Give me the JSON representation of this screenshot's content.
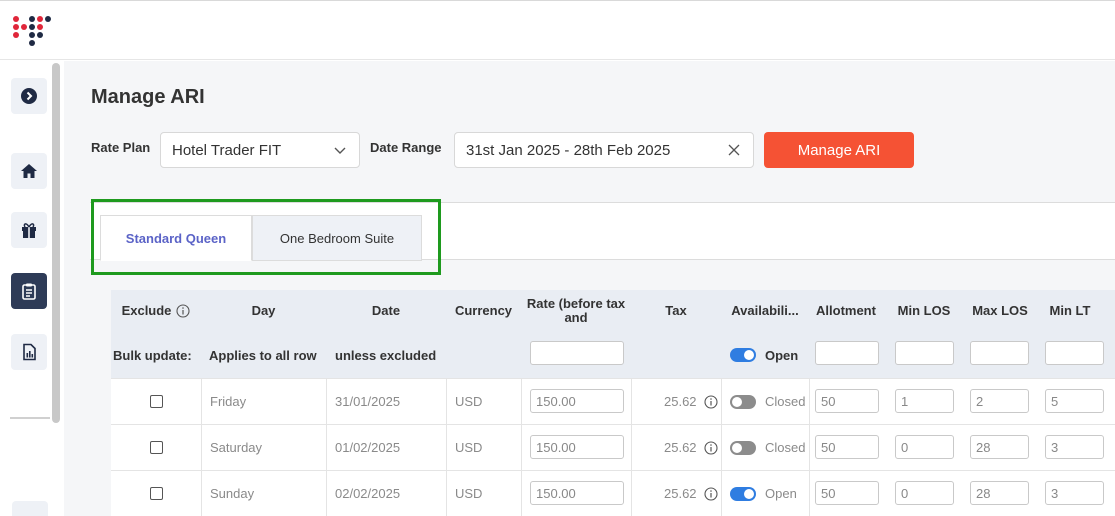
{
  "page": {
    "title": "Manage ARI"
  },
  "filters": {
    "rate_plan_label": "Rate Plan",
    "rate_plan_value": "Hotel Trader FIT",
    "date_range_label": "Date Range",
    "date_range_value": "31st Jan 2025 - 28th Feb 2025",
    "manage_button": "Manage ARI"
  },
  "tabs": [
    {
      "label": "Standard Queen",
      "active": true
    },
    {
      "label": "One Bedroom Suite",
      "active": false
    }
  ],
  "table": {
    "headers": {
      "exclude": "Exclude",
      "day": "Day",
      "date": "Date",
      "currency": "Currency",
      "rate": "Rate (before tax and",
      "tax": "Tax",
      "availability": "Availabili...",
      "allotment": "Allotment",
      "min_los": "Min LOS",
      "max_los": "Max LOS",
      "min_lt": "Min LT"
    },
    "bulk": {
      "label": "Bulk update:",
      "applies": "Applies to all row",
      "unless": "unless excluded",
      "status": "Open"
    },
    "rows": [
      {
        "day": "Friday",
        "date": "31/01/2025",
        "currency": "USD",
        "rate": "150.00",
        "tax": "25.62",
        "status": "Closed",
        "open": false,
        "allotment": "50",
        "min_los": "1",
        "max_los": "2",
        "min_lt": "5"
      },
      {
        "day": "Saturday",
        "date": "01/02/2025",
        "currency": "USD",
        "rate": "150.00",
        "tax": "25.62",
        "status": "Closed",
        "open": false,
        "allotment": "50",
        "min_los": "0",
        "max_los": "28",
        "min_lt": "3"
      },
      {
        "day": "Sunday",
        "date": "02/02/2025",
        "currency": "USD",
        "rate": "150.00",
        "tax": "25.62",
        "status": "Open",
        "open": true,
        "allotment": "50",
        "min_los": "0",
        "max_los": "28",
        "min_lt": "3"
      }
    ]
  },
  "colors": {
    "accent": "#f55234",
    "tab_active": "#5b63c7",
    "highlight": "#1e9a1e",
    "toggle_on": "#2f7de1"
  },
  "icons": [
    "logo-icon",
    "chevron-right-icon",
    "home-icon",
    "gift-icon",
    "clipboard-icon",
    "report-icon",
    "chevron-down-icon",
    "close-icon",
    "info-icon"
  ]
}
